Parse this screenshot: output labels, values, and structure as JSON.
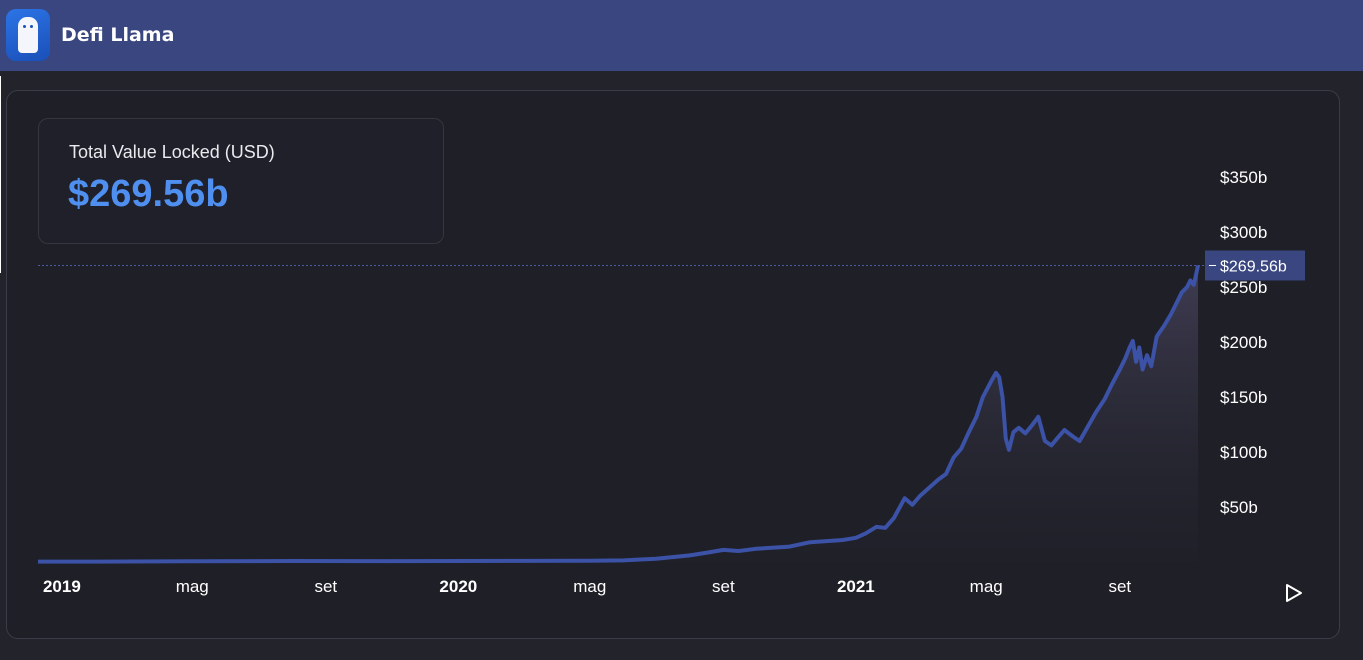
{
  "header": {
    "brand": "Defi Llama",
    "logo_icon": "llama-logo-icon",
    "background": "#394680"
  },
  "tvl": {
    "label": "Total Value Locked (USD)",
    "value": "$269.56b",
    "value_color": "#4f8ff0"
  },
  "controls": {
    "play_icon": "play-icon"
  },
  "chart_data": {
    "type": "area",
    "title": "",
    "xlabel": "",
    "ylabel": "",
    "ylim": [
      0,
      350
    ],
    "y_unit": "billion USD",
    "y_ticks": [
      {
        "value": 50,
        "label": "$50b"
      },
      {
        "value": 100,
        "label": "$100b"
      },
      {
        "value": 150,
        "label": "$150b"
      },
      {
        "value": 200,
        "label": "$200b"
      },
      {
        "value": 250,
        "label": "$250b"
      },
      {
        "value": 300,
        "label": "$300b"
      },
      {
        "value": 350,
        "label": "$350b"
      }
    ],
    "x_ticks": [
      {
        "date": "2019-01-01",
        "label": "2019",
        "bold": true
      },
      {
        "date": "2019-05-01",
        "label": "mag",
        "bold": false
      },
      {
        "date": "2019-09-01",
        "label": "set",
        "bold": false
      },
      {
        "date": "2020-01-01",
        "label": "2020",
        "bold": true
      },
      {
        "date": "2020-05-01",
        "label": "mag",
        "bold": false
      },
      {
        "date": "2020-09-01",
        "label": "set",
        "bold": false
      },
      {
        "date": "2021-01-01",
        "label": "2021",
        "bold": true
      },
      {
        "date": "2021-05-01",
        "label": "mag",
        "bold": false
      },
      {
        "date": "2021-09-01",
        "label": "set",
        "bold": false
      }
    ],
    "current": {
      "value": 269.56,
      "label": "$269.56b"
    },
    "line_color": "#3b52a6",
    "grid": false,
    "series": [
      {
        "points": [
          [
            "2018-12-10",
            0.4
          ],
          [
            "2019-02-01",
            0.4
          ],
          [
            "2019-05-01",
            0.6
          ],
          [
            "2019-08-01",
            0.9
          ],
          [
            "2019-11-01",
            0.8
          ],
          [
            "2020-01-01",
            0.9
          ],
          [
            "2020-03-01",
            1.0
          ],
          [
            "2020-05-01",
            1.2
          ],
          [
            "2020-06-01",
            1.5
          ],
          [
            "2020-07-01",
            3.0
          ],
          [
            "2020-08-01",
            6.0
          ],
          [
            "2020-08-20",
            9.0
          ],
          [
            "2020-09-01",
            11.0
          ],
          [
            "2020-09-15",
            10.0
          ],
          [
            "2020-10-01",
            12.0
          ],
          [
            "2020-11-01",
            14.0
          ],
          [
            "2020-11-20",
            18.0
          ],
          [
            "2020-12-05",
            19.0
          ],
          [
            "2020-12-20",
            20.0
          ],
          [
            "2021-01-01",
            22.0
          ],
          [
            "2021-01-10",
            26.0
          ],
          [
            "2021-01-20",
            32.0
          ],
          [
            "2021-01-28",
            31.0
          ],
          [
            "2021-02-05",
            40.0
          ],
          [
            "2021-02-15",
            58.0
          ],
          [
            "2021-02-22",
            52.0
          ],
          [
            "2021-03-01",
            60.0
          ],
          [
            "2021-03-10",
            68.0
          ],
          [
            "2021-03-18",
            75.0
          ],
          [
            "2021-03-25",
            80.0
          ],
          [
            "2021-04-01",
            95.0
          ],
          [
            "2021-04-08",
            103.0
          ],
          [
            "2021-04-15",
            118.0
          ],
          [
            "2021-04-22",
            132.0
          ],
          [
            "2021-04-28",
            150.0
          ],
          [
            "2021-05-06",
            165.0
          ],
          [
            "2021-05-10",
            172.0
          ],
          [
            "2021-05-13",
            168.0
          ],
          [
            "2021-05-16",
            150.0
          ],
          [
            "2021-05-19",
            112.0
          ],
          [
            "2021-05-22",
            102.0
          ],
          [
            "2021-05-26",
            118.0
          ],
          [
            "2021-05-31",
            122.0
          ],
          [
            "2021-06-06",
            117.0
          ],
          [
            "2021-06-12",
            124.0
          ],
          [
            "2021-06-18",
            132.0
          ],
          [
            "2021-06-24",
            110.0
          ],
          [
            "2021-06-30",
            106.0
          ],
          [
            "2021-07-05",
            112.0
          ],
          [
            "2021-07-12",
            120.0
          ],
          [
            "2021-07-20",
            114.0
          ],
          [
            "2021-07-26",
            110.0
          ],
          [
            "2021-08-02",
            122.0
          ],
          [
            "2021-08-10",
            136.0
          ],
          [
            "2021-08-18",
            148.0
          ],
          [
            "2021-08-25",
            162.0
          ],
          [
            "2021-09-01",
            175.0
          ],
          [
            "2021-09-06",
            185.0
          ],
          [
            "2021-09-10",
            195.0
          ],
          [
            "2021-09-13",
            201.0
          ],
          [
            "2021-09-16",
            182.0
          ],
          [
            "2021-09-19",
            195.0
          ],
          [
            "2021-09-22",
            175.0
          ],
          [
            "2021-09-26",
            188.0
          ],
          [
            "2021-09-30",
            178.0
          ],
          [
            "2021-10-05",
            205.0
          ],
          [
            "2021-10-12",
            215.0
          ],
          [
            "2021-10-18",
            225.0
          ],
          [
            "2021-10-23",
            235.0
          ],
          [
            "2021-10-28",
            245.0
          ],
          [
            "2021-11-02",
            250.0
          ],
          [
            "2021-11-05",
            256.0
          ],
          [
            "2021-11-08",
            252.0
          ],
          [
            "2021-11-10",
            260.0
          ],
          [
            "2021-11-12",
            269.56
          ]
        ]
      }
    ]
  }
}
